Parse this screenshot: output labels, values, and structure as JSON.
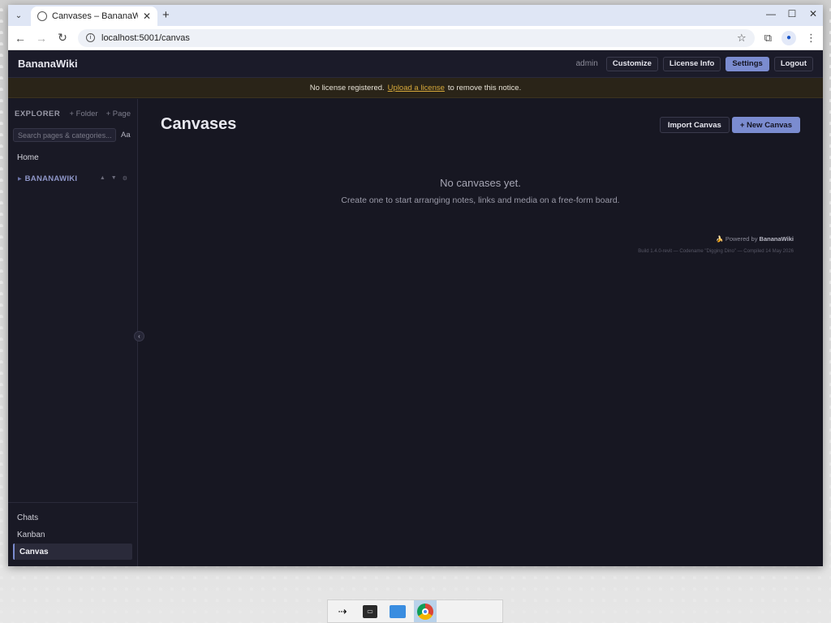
{
  "browser": {
    "tab_title": "Canvases – BananaWiki",
    "url": "localhost:5001/canvas",
    "icons": {
      "tab_menu": "chevron-down-icon",
      "tab_favicon": "globe-icon",
      "tab_close": "close-icon",
      "new_tab": "plus-icon",
      "minimize": "minimize-icon",
      "maximize": "maximize-icon",
      "close": "close-icon",
      "back": "arrow-left-icon",
      "forward": "arrow-right-icon",
      "reload": "reload-icon",
      "site_info": "info-icon",
      "bookmark": "star-icon",
      "extensions": "puzzle-icon",
      "profile": "person-icon",
      "menu": "kebab-icon"
    }
  },
  "header": {
    "brand": "BananaWiki",
    "user": "admin",
    "buttons": {
      "customize": "Customize",
      "license": "License Info",
      "settings": "Settings",
      "logout": "Logout"
    },
    "accent_color": "#7b8cd0"
  },
  "notice": {
    "before": "No license registered.",
    "link": "Upload a license",
    "after": "to remove this notice."
  },
  "sidebar": {
    "label": "EXPLORER",
    "add_folder": "+ Folder",
    "add_page": "+ Page",
    "search_placeholder": "Search pages & categories...",
    "case_toggle": "Aa",
    "home": "Home",
    "category": {
      "name": "BANANAWIKI",
      "up": "▲",
      "down": "▼",
      "settings": "⚙"
    },
    "bottom_nav": [
      {
        "label": "Chats",
        "active": false
      },
      {
        "label": "Kanban",
        "active": false
      },
      {
        "label": "Canvas",
        "active": true
      }
    ]
  },
  "content": {
    "title": "Canvases",
    "import_label": "Import Canvas",
    "new_label": "+ New Canvas",
    "empty_heading": "No canvases yet.",
    "empty_sub": "Create one to start arranging notes, links and media on a free-form board.",
    "powered_prefix": "🍌 Powered by",
    "powered_brand": "BananaWiki",
    "build": "Build 1.4.0-revit — Codename \"Digging Dino\" — Compiled 14 May 2026"
  },
  "taskbar": {
    "items": [
      "pointer-app-icon",
      "terminal-icon",
      "files-icon",
      "chrome-icon"
    ]
  }
}
